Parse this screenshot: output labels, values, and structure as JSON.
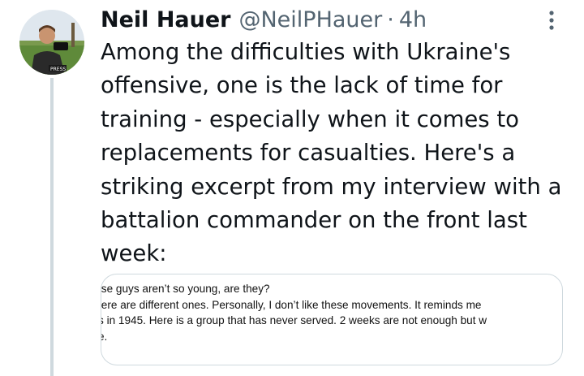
{
  "tweet": {
    "author_name": "Neil Hauer",
    "handle": "@NeilPHauer",
    "separator": "·",
    "time": "4h",
    "more_icon": "more-vertical-icon",
    "text": "Among the difficulties with Ukraine's offensive, one is the lack of time for training - especially when it comes to replacements for casualties. Here's a striking excerpt from my interview with a battalion commander on the front last week:",
    "avatar_badge": "PRESS",
    "media": {
      "lines": [
        "ıse guys aren’t so young, are they?",
        "ıere are different ones. Personally, I don’t like these movements. It reminds me",
        "s in 1945. Here is a group that has never served. 2 weeks are not enough but w",
        "e."
      ]
    }
  },
  "colors": {
    "text_primary": "#0f1419",
    "text_secondary": "#536471",
    "border": "#cfd9de"
  }
}
